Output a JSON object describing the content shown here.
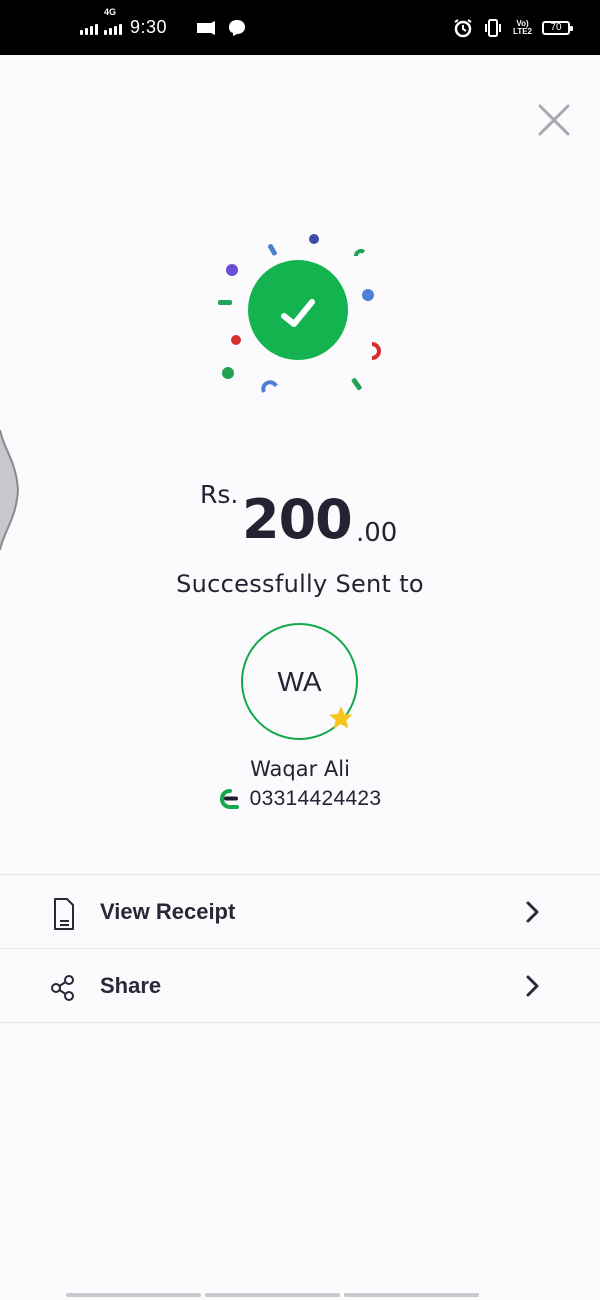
{
  "status_bar": {
    "network": "4G",
    "time": "9:30",
    "volte": "Vo)",
    "lte": "LTE2",
    "battery": "70"
  },
  "transaction": {
    "currency": "Rs.",
    "amount_whole": "200",
    "amount_decimal": ".00",
    "status_text": "Successfully Sent to"
  },
  "recipient": {
    "initials": "WA",
    "name": "Waqar Ali",
    "phone": "03314424423"
  },
  "actions": [
    {
      "label": "View Receipt",
      "icon": "receipt-icon"
    },
    {
      "label": "Share",
      "icon": "share-icon"
    }
  ],
  "colors": {
    "success_green": "#13a94b",
    "text_dark": "#252232",
    "star_yellow": "#f7c51e"
  }
}
